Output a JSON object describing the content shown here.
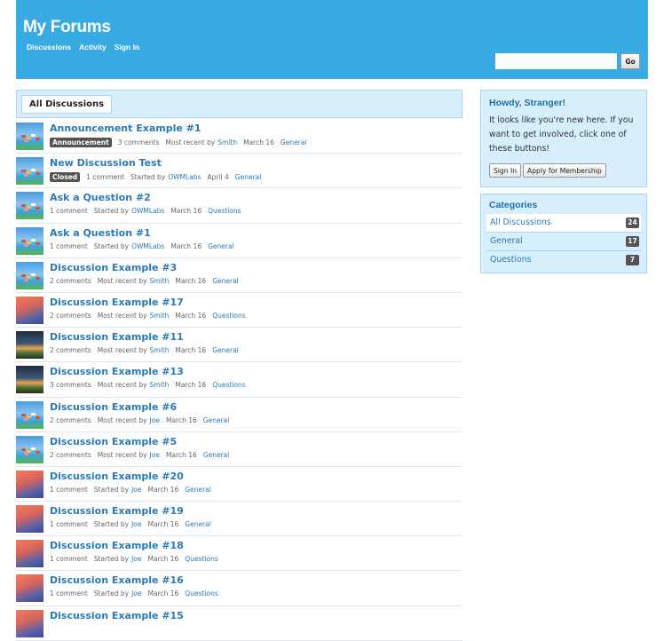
{
  "header": {
    "site_title": "My Forums",
    "nav": [
      "Discussions",
      "Activity",
      "Sign In"
    ],
    "search_button": "Go",
    "search_value": ""
  },
  "tabs": {
    "active": "All Discussions"
  },
  "discussions": [
    {
      "title": "Announcement Example #1",
      "badge": "Announcement",
      "comments": "3 comments",
      "action": "Most recent by",
      "user": "Smith",
      "date": "March 16",
      "category": "General",
      "avatar": "a"
    },
    {
      "title": "New Discussion Test",
      "badge": "Closed",
      "comments": "1 comment",
      "action": "Started by",
      "user": "OWMLabs",
      "date": "April 4",
      "category": "General",
      "avatar": "a"
    },
    {
      "title": "Ask a Question #2",
      "badge": "",
      "comments": "1 comment",
      "action": "Started by",
      "user": "OWMLabs",
      "date": "March 16",
      "category": "Questions",
      "avatar": "a"
    },
    {
      "title": "Ask a Question #1",
      "badge": "",
      "comments": "1 comment",
      "action": "Started by",
      "user": "OWMLabs",
      "date": "March 16",
      "category": "General",
      "avatar": "a"
    },
    {
      "title": "Discussion Example #3",
      "badge": "",
      "comments": "2 comments",
      "action": "Most recent by",
      "user": "Smith",
      "date": "March 16",
      "category": "General",
      "avatar": "a"
    },
    {
      "title": "Discussion Example #17",
      "badge": "",
      "comments": "2 comments",
      "action": "Most recent by",
      "user": "Smith",
      "date": "March 16",
      "category": "Questions",
      "avatar": "b"
    },
    {
      "title": "Discussion Example #11",
      "badge": "",
      "comments": "2 comments",
      "action": "Most recent by",
      "user": "Smith",
      "date": "March 16",
      "category": "General",
      "avatar": "c"
    },
    {
      "title": "Discussion Example #13",
      "badge": "",
      "comments": "3 comments",
      "action": "Most recent by",
      "user": "Smith",
      "date": "March 16",
      "category": "Questions",
      "avatar": "c"
    },
    {
      "title": "Discussion Example #6",
      "badge": "",
      "comments": "2 comments",
      "action": "Most recent by",
      "user": "Joe",
      "date": "March 16",
      "category": "General",
      "avatar": "a"
    },
    {
      "title": "Discussion Example #5",
      "badge": "",
      "comments": "2 comments",
      "action": "Most recent by",
      "user": "Joe",
      "date": "March 16",
      "category": "General",
      "avatar": "a"
    },
    {
      "title": "Discussion Example #20",
      "badge": "",
      "comments": "1 comment",
      "action": "Started by",
      "user": "Joe",
      "date": "March 16",
      "category": "General",
      "avatar": "b"
    },
    {
      "title": "Discussion Example #19",
      "badge": "",
      "comments": "1 comment",
      "action": "Started by",
      "user": "Joe",
      "date": "March 16",
      "category": "General",
      "avatar": "b"
    },
    {
      "title": "Discussion Example #18",
      "badge": "",
      "comments": "1 comment",
      "action": "Started by",
      "user": "Joe",
      "date": "March 16",
      "category": "Questions",
      "avatar": "b"
    },
    {
      "title": "Discussion Example #16",
      "badge": "",
      "comments": "1 comment",
      "action": "Started by",
      "user": "Joe",
      "date": "March 16",
      "category": "Questions",
      "avatar": "b"
    },
    {
      "title": "Discussion Example #15",
      "badge": "",
      "comments": "",
      "action": "",
      "user": "",
      "date": "",
      "category": "",
      "avatar": "b"
    }
  ],
  "howdy": {
    "title": "Howdy, Stranger!",
    "text": "It looks like you're new here. If you want to get involved, click one of these buttons!",
    "sign_in": "Sign In",
    "apply": "Apply for Membership"
  },
  "categories": {
    "title": "Categories",
    "items": [
      {
        "name": "All Discussions",
        "count": "24"
      },
      {
        "name": "General",
        "count": "17"
      },
      {
        "name": "Questions",
        "count": "7"
      }
    ]
  },
  "colors": {
    "header": "#38abe3",
    "link": "#2a7ab6",
    "panel": "#d7eefd",
    "badge": "#545454"
  }
}
